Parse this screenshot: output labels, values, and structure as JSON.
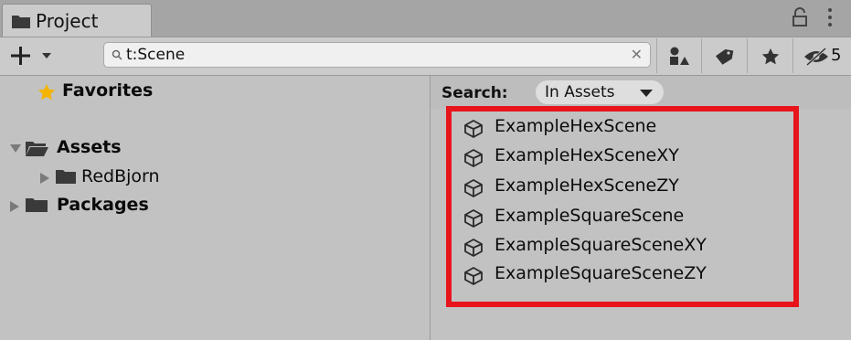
{
  "window": {
    "tab_title": "Project",
    "lock_icon": "lock-icon",
    "menu_icon": "kebab-menu-icon"
  },
  "toolbar": {
    "create_icon": "plus-icon",
    "search": {
      "value": "t:Scene",
      "placeholder": ""
    },
    "buttons": [
      {
        "icon": "search-by-type-icon"
      },
      {
        "icon": "search-by-label-icon"
      },
      {
        "icon": "save-search-star-icon"
      },
      {
        "icon": "hidden-packages-icon",
        "count": "5"
      }
    ]
  },
  "tree": {
    "favorites": {
      "label": "Favorites",
      "icon": "star-icon"
    },
    "assets": {
      "label": "Assets",
      "icon": "folder-open-icon",
      "expanded": true
    },
    "redbjorn": {
      "label": "RedBjorn",
      "icon": "folder-icon",
      "expanded": false
    },
    "packages": {
      "label": "Packages",
      "icon": "folder-icon",
      "expanded": false
    }
  },
  "results": {
    "search_label": "Search:",
    "scope": "In Assets",
    "items": [
      {
        "label": "ExampleHexScene",
        "icon": "unity-scene-icon"
      },
      {
        "label": "ExampleHexSceneXY",
        "icon": "unity-scene-icon"
      },
      {
        "label": "ExampleHexSceneZY",
        "icon": "unity-scene-icon"
      },
      {
        "label": "ExampleSquareScene",
        "icon": "unity-scene-icon"
      },
      {
        "label": "ExampleSquareSceneXY",
        "icon": "unity-scene-icon"
      },
      {
        "label": "ExampleSquareSceneZY",
        "icon": "unity-scene-icon"
      }
    ]
  },
  "colors": {
    "panel_bg": "#c2c2c2",
    "tab_bg": "#cbcbcb",
    "highlight": "#e8141c",
    "star": "#f4b400"
  }
}
